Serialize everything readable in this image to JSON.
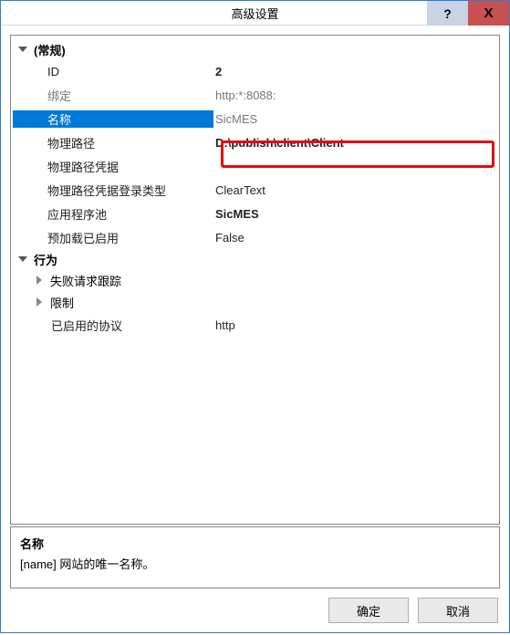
{
  "window": {
    "title": "高级设置"
  },
  "titlebuttons": {
    "help": "?",
    "close": "X"
  },
  "categories": {
    "general": {
      "label": "(常规)",
      "props": {
        "id": {
          "label": "ID",
          "value": "2"
        },
        "binding": {
          "label": "绑定",
          "value": "http:*:8088:"
        },
        "name": {
          "label": "名称",
          "value": "SicMES"
        },
        "physicalPath": {
          "label": "物理路径",
          "value": "D:\\publish\\client\\Client"
        },
        "physicalPathCred": {
          "label": "物理路径凭据",
          "value": ""
        },
        "physicalPathCredLogonType": {
          "label": "物理路径凭据登录类型",
          "value": "ClearText"
        },
        "appPool": {
          "label": "应用程序池",
          "value": "SicMES"
        },
        "preloadEnabled": {
          "label": "预加载已启用",
          "value": "False"
        }
      }
    },
    "behavior": {
      "label": "行为",
      "sub": {
        "failedReqTracing": {
          "label": "失败请求跟踪"
        },
        "limits": {
          "label": "限制"
        },
        "enabledProtocols": {
          "label": "已启用的协议",
          "value": "http"
        }
      }
    }
  },
  "description": {
    "title": "名称",
    "text": "[name] 网站的唯一名称。"
  },
  "buttons": {
    "ok": "确定",
    "cancel": "取消"
  }
}
